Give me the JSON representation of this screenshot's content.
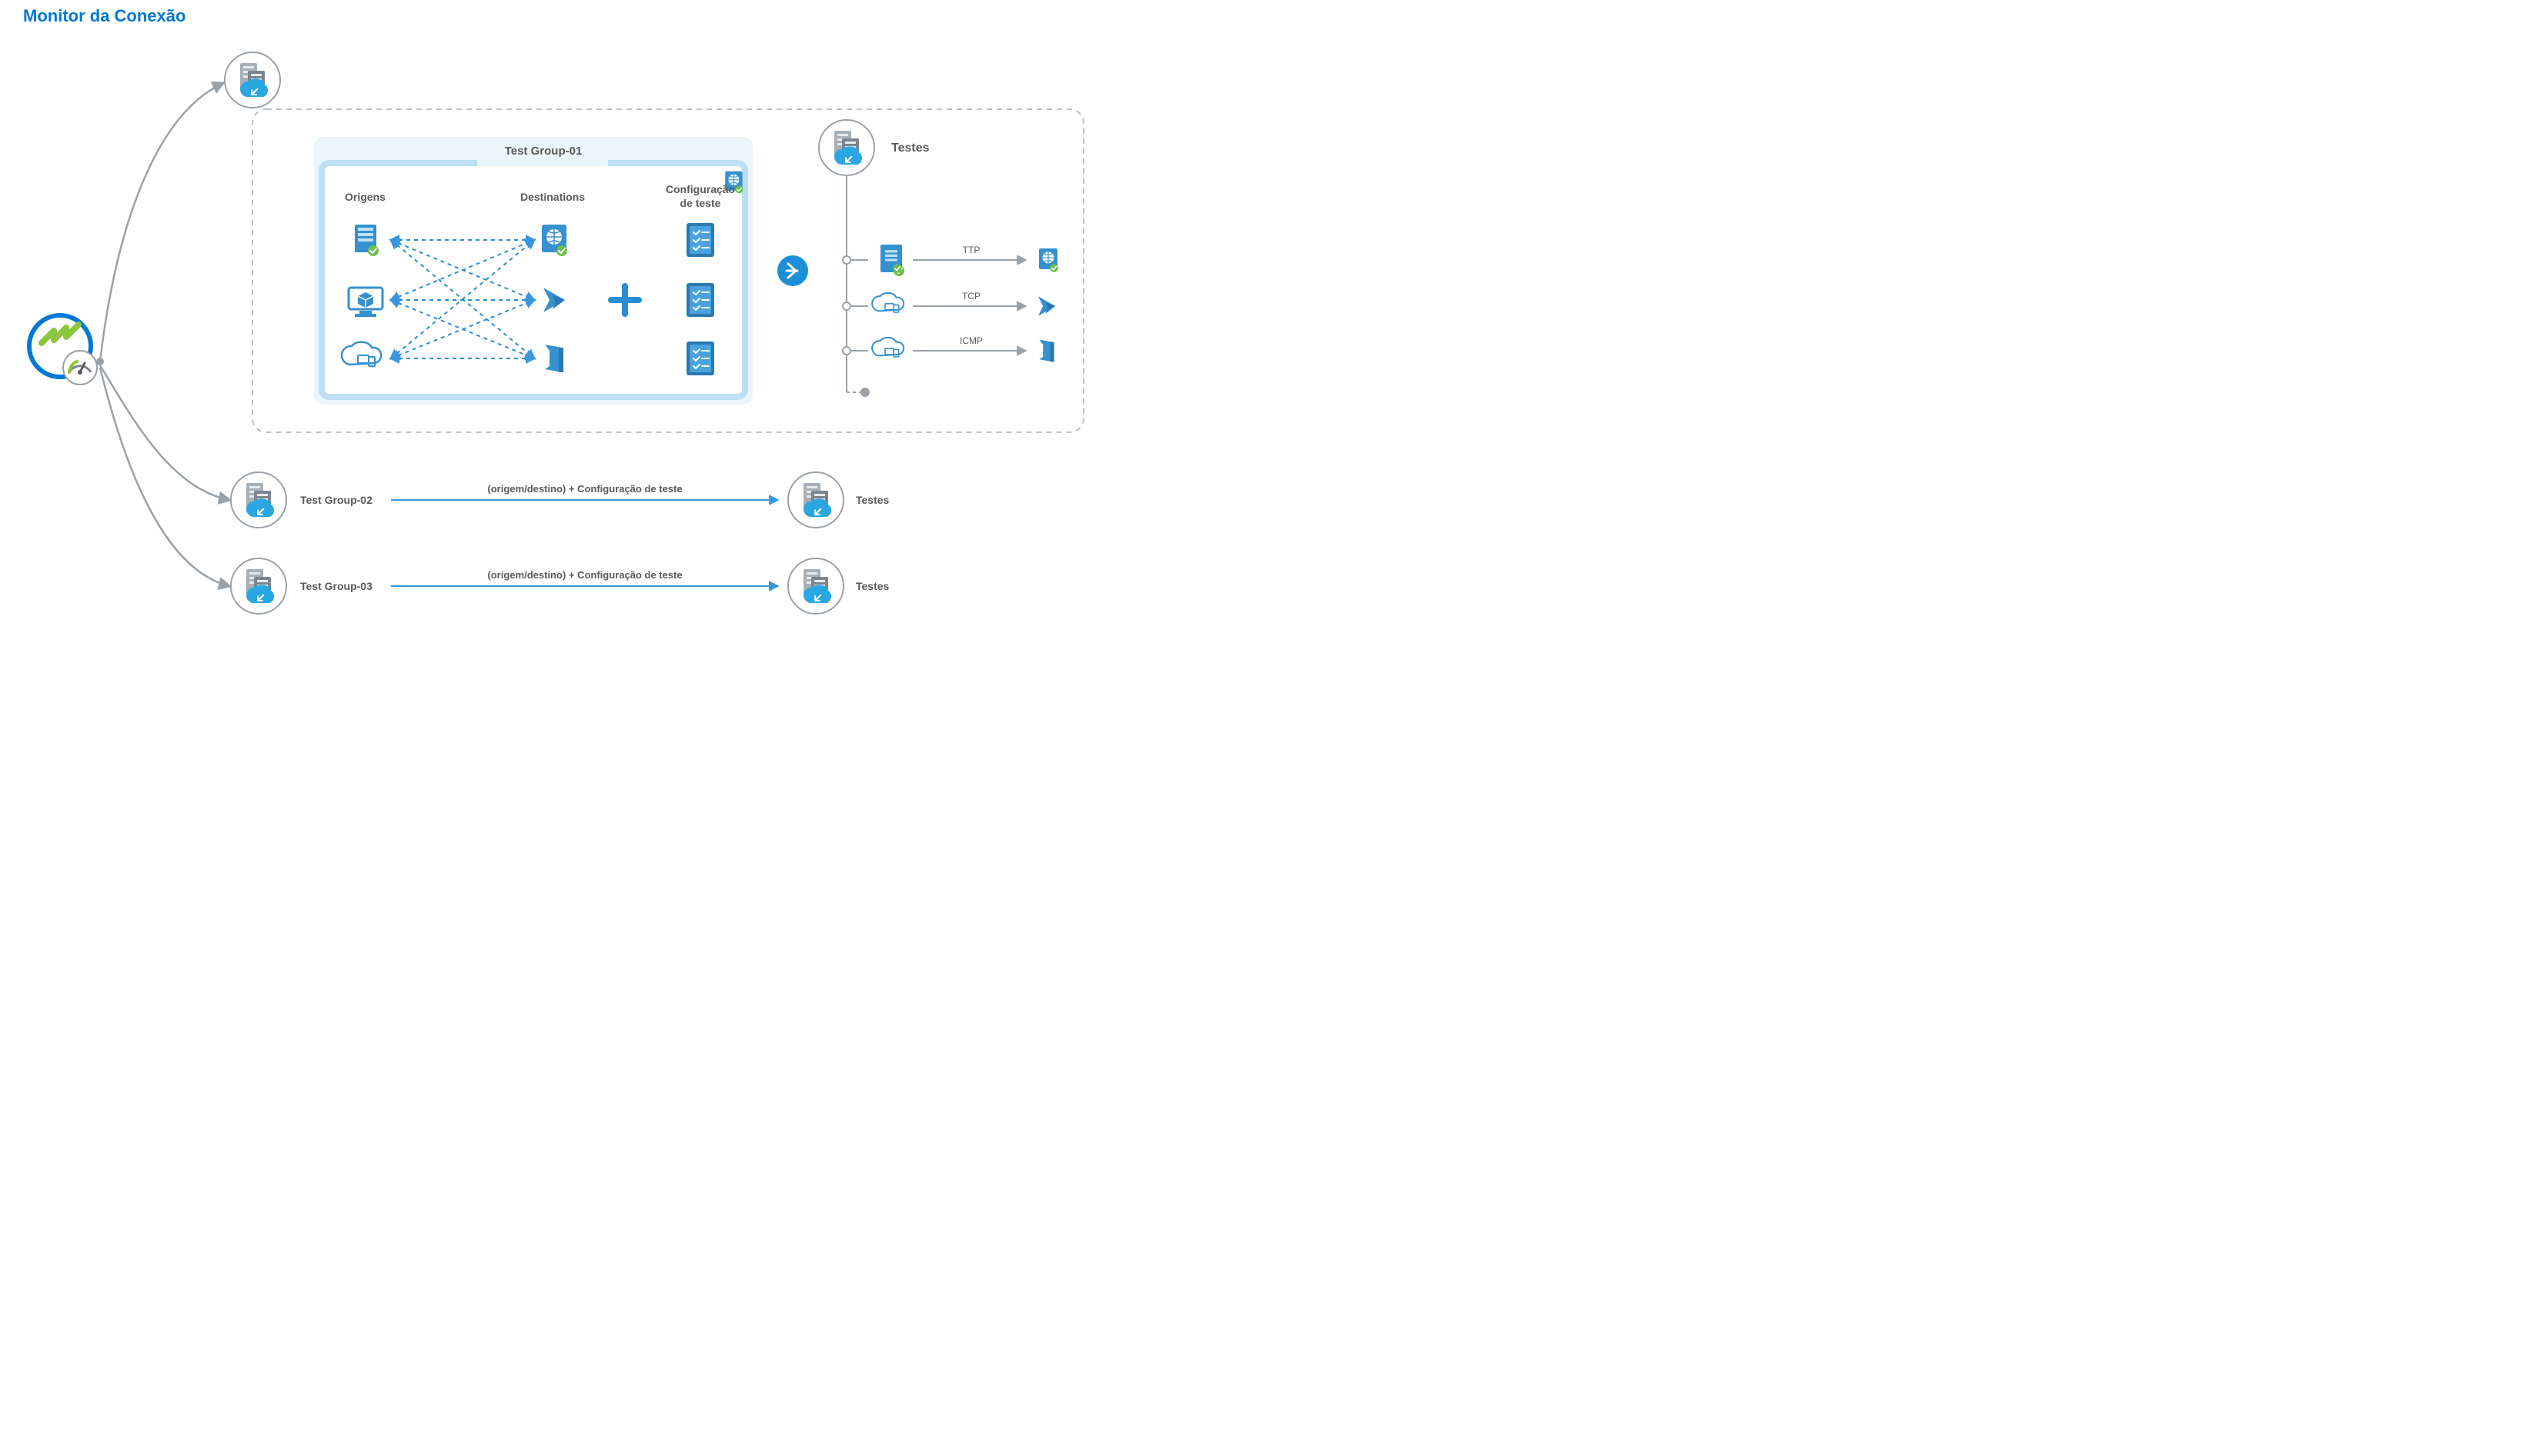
{
  "title": "Monitor da Conexão",
  "groups": {
    "group1": {
      "name": "Test Group-01"
    },
    "group2": {
      "name": "Test Group-02",
      "mid": "(origem/destino) + Configuração de teste",
      "right": "Testes"
    },
    "group3": {
      "name": "Test Group-03",
      "mid": "(origem/destino) + Configuração de teste",
      "right": "Testes"
    }
  },
  "panel": {
    "col1": "Origens",
    "col2": "Destinations",
    "col3": "Configuração\nde teste"
  },
  "right": {
    "title": "Testes",
    "rows": [
      "TTP",
      "TCP",
      "ICMP"
    ]
  }
}
